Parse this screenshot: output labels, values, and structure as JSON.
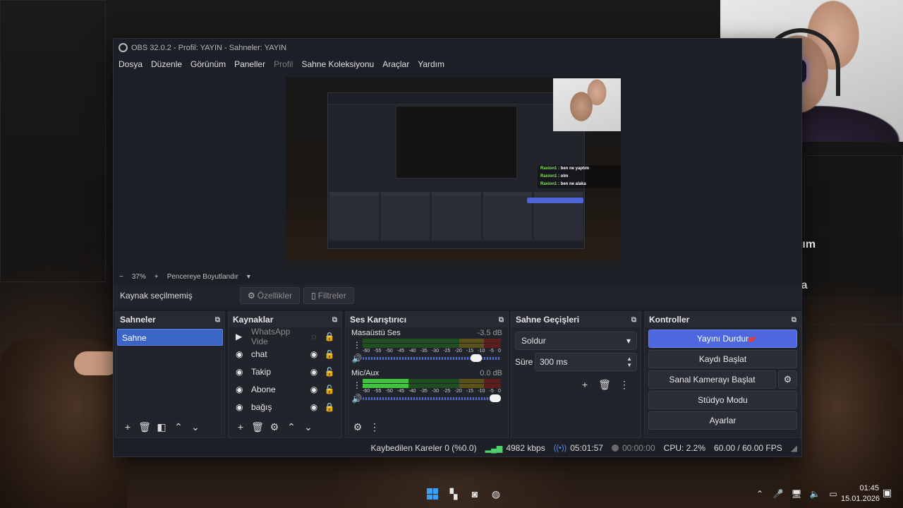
{
  "window": {
    "title": "OBS 32.0.2 - Profil: YAYIN - Sahneler: YAYIN",
    "menu": [
      "Dosya",
      "Düzenle",
      "Görünüm",
      "Paneller",
      "Profil",
      "Sahne Koleksiyonu",
      "Araçlar",
      "Yardım"
    ]
  },
  "preview": {
    "zoom_minus": "−",
    "zoom": "37%",
    "zoom_plus": "+",
    "fit_label": "Pencereye Boyutlandır"
  },
  "source_bar": {
    "no_source": "Kaynak seçilmemiş",
    "properties": "Özellikler",
    "filters": "Filtreler"
  },
  "scenes": {
    "title": "Sahneler",
    "items": [
      "Sahne"
    ]
  },
  "sources": {
    "title": "Kaynaklar",
    "items": [
      {
        "name": "WhatsApp Vide",
        "icon": "play-icon",
        "visible": false,
        "locked": true
      },
      {
        "name": "chat",
        "icon": "globe-icon",
        "visible": true,
        "locked": true
      },
      {
        "name": "Takip",
        "icon": "globe-icon",
        "visible": true,
        "locked": false
      },
      {
        "name": "Abone",
        "icon": "globe-icon",
        "visible": true,
        "locked": false
      },
      {
        "name": "bağış",
        "icon": "globe-icon",
        "visible": true,
        "locked": true
      }
    ]
  },
  "mixer": {
    "title": "Ses Karıştırıcı",
    "scale": [
      "-60",
      "-55",
      "-50",
      "-45",
      "-40",
      "-35",
      "-30",
      "-25",
      "-20",
      "-15",
      "-10",
      "-5",
      "0"
    ],
    "channels": [
      {
        "name": "Masaüstü Ses",
        "db": "-3.5 dB",
        "level": 0.0,
        "volume": 0.86
      },
      {
        "name": "Mic/Aux",
        "db": "0.0 dB",
        "level": 0.33,
        "volume": 1.0
      }
    ]
  },
  "transitions": {
    "title": "Sahne Geçişleri",
    "selected": "Soldur",
    "duration_label": "Süre",
    "duration_value": "300 ms"
  },
  "controls": {
    "title": "Kontroller",
    "stop_stream": "Yayını Durdur",
    "start_record": "Kaydı Başlat",
    "start_virtualcam": "Sanal Kamerayı Başlat",
    "studio_mode": "Stüdyo Modu",
    "settings": "Ayarlar"
  },
  "status": {
    "dropped": "Kaybedilen Kareler 0 (%0.0)",
    "bitrate": "4982 kbps",
    "stream_time": "05:01:57",
    "rec_time": "00:00:00",
    "cpu": "CPU: 2.2%",
    "fps": "60.00 / 60.00 FPS"
  },
  "chat_overlay": [
    {
      "user": "Raxion1",
      "message": " : ben ne yaptım"
    },
    {
      "user": "Raxion1",
      "message": " : olm"
    },
    {
      "user": "Raxion1",
      "message": " : ben ne alaka"
    }
  ],
  "taskbar": {
    "time": "01:45",
    "date": "15.01.2026"
  },
  "colors": {
    "accent": "#4d67df",
    "chat_user": "#7cf03c",
    "scene_selected": "#3b64c7",
    "meter_green": "#3fc43f",
    "meter_yellow": "#d8c23a",
    "meter_red": "#d93b3b"
  }
}
